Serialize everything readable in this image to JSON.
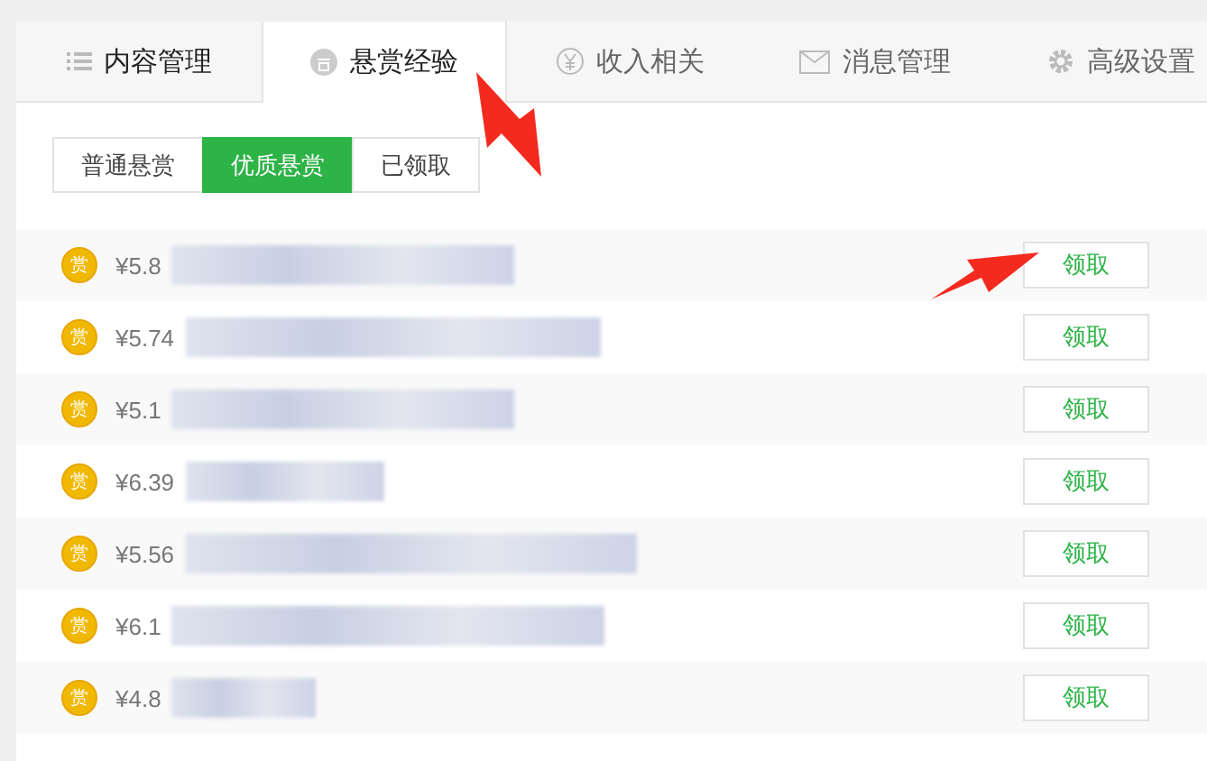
{
  "tabs": [
    {
      "label": "内容管理",
      "kind": "list",
      "selected": false
    },
    {
      "label": "悬赏经验",
      "kind": "coin",
      "selected": true
    },
    {
      "label": "收入相关",
      "kind": "yen",
      "selected": false
    },
    {
      "label": "消息管理",
      "kind": "mail",
      "selected": false
    },
    {
      "label": "高级设置",
      "kind": "gear",
      "selected": false
    }
  ],
  "sub_tabs": [
    {
      "label": "普通悬赏",
      "selected": false
    },
    {
      "label": "优质悬赏",
      "selected": true
    },
    {
      "label": "已领取",
      "selected": false
    }
  ],
  "rows": [
    {
      "coin": "赏",
      "price": "¥5.8",
      "button": "领取"
    },
    {
      "coin": "赏",
      "price": "¥5.74",
      "button": "领取"
    },
    {
      "coin": "赏",
      "price": "¥5.1",
      "button": "领取"
    },
    {
      "coin": "赏",
      "price": "¥6.39",
      "button": "领取"
    },
    {
      "coin": "赏",
      "price": "¥5.56",
      "button": "领取"
    },
    {
      "coin": "赏",
      "price": "¥6.1",
      "button": "领取"
    },
    {
      "coin": "赏",
      "price": "¥4.8",
      "button": "领取"
    }
  ]
}
